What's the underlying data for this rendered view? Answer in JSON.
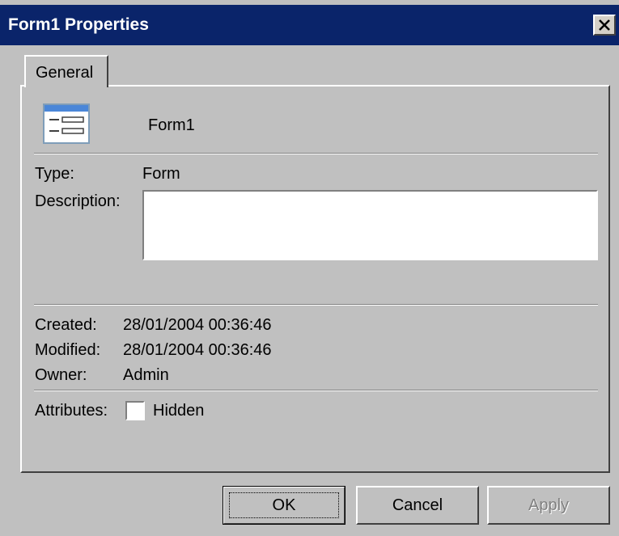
{
  "window": {
    "title": "Form1 Properties"
  },
  "tabs": [
    {
      "label": "General",
      "selected": true
    }
  ],
  "object": {
    "name": "Form1",
    "icon": "form-icon"
  },
  "fields": {
    "type_label": "Type:",
    "type_value": "Form",
    "description_label": "Description:",
    "description_value": ""
  },
  "info": {
    "created_label": "Created:",
    "created_value": "28/01/2004 00:36:46",
    "modified_label": "Modified:",
    "modified_value": "28/01/2004 00:36:46",
    "owner_label": "Owner:",
    "owner_value": "Admin"
  },
  "attributes": {
    "label": "Attributes:",
    "hidden_label": "Hidden",
    "hidden_checked": false
  },
  "buttons": {
    "ok": "OK",
    "cancel": "Cancel",
    "apply": "Apply",
    "apply_enabled": false
  },
  "colors": {
    "titlebar": "#0a246a",
    "face": "#c0c0c0",
    "disabled_text": "#808080"
  }
}
